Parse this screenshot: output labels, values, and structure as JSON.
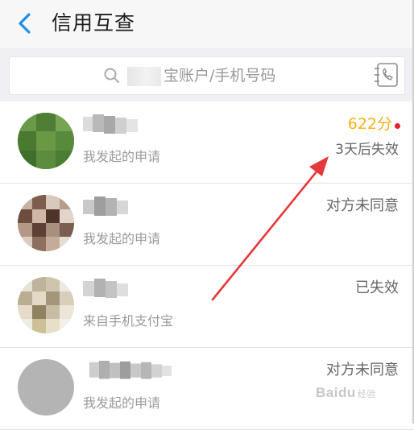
{
  "header": {
    "title": "信用互查",
    "back_icon": "chevron-left-icon"
  },
  "search": {
    "placeholder": "宝账户/手机号码",
    "icon": "search-icon",
    "contact_icon": "contact-phone-icon"
  },
  "rows": [
    {
      "sub": "我发起的申请",
      "right_top": "622分",
      "right_bottom": "3天后失效",
      "has_dot": true
    },
    {
      "sub": "我发起的申请",
      "right_top": "对方未同意"
    },
    {
      "sub": "来自手机支付宝",
      "right_top": "已失效"
    },
    {
      "sub": "我发起的申请",
      "right_top": "对方未同意"
    }
  ],
  "colors": {
    "accent_blue": "#1f8fe6",
    "score_orange": "#f5b21b",
    "dot_red": "#e4222a",
    "annotation_red": "#e5383b"
  },
  "watermark": {
    "main": "Baidu",
    "sub": "经验"
  }
}
